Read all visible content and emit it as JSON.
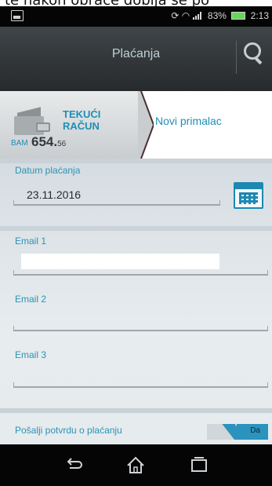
{
  "top_clip_text": "te nakon obraće dobija se po",
  "status_bar": {
    "battery_percent": "83%",
    "time": "2:13"
  },
  "header": {
    "title": "Plaćanja"
  },
  "account": {
    "name_line1": "TEKUĆI",
    "name_line2": "RAČUN",
    "currency": "BAM",
    "amount_main": "654.",
    "amount_cents": "56"
  },
  "recipient": {
    "label": "Novi primalac"
  },
  "form": {
    "date_label": "Datum plaćanja",
    "date_value": "23.11.2016",
    "email1_label": "Email 1",
    "email1_value": "",
    "email2_label": "Email 2",
    "email3_label": "Email 3",
    "confirm_label": "Pošalji potvrdu o plaćanju",
    "toggle_value": "Da"
  },
  "colors": {
    "accent": "#1f8fb5",
    "header_bg": "#2f3436",
    "toggle_on": "#2b93bd"
  },
  "icons": {
    "search": "search-icon",
    "calendar": "calendar-icon",
    "back": "back-icon",
    "home": "home-icon",
    "recents": "recent-apps-icon",
    "wallet": "wallet-icon"
  }
}
